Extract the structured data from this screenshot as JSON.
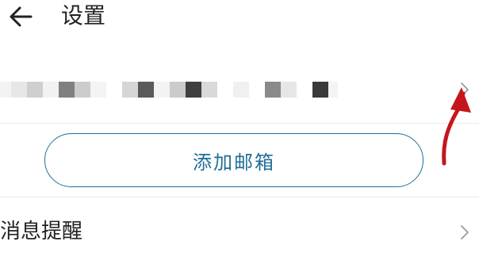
{
  "header": {
    "title": "设置",
    "back_icon": "arrow-left-icon"
  },
  "account": {
    "masked_text": "",
    "chevron_icon": "chevron-right-icon"
  },
  "add_mail": {
    "label": "添加邮箱"
  },
  "notification": {
    "label": "消息提醒",
    "chevron_icon": "chevron-right-icon"
  },
  "annotation": {
    "arrow_icon": "red-pointer-arrow-icon",
    "color": "#c4161c"
  },
  "colors": {
    "accent": "#1f6e97",
    "text": "#222222",
    "divider": "#e9e9e9",
    "chevron": "#9a9a9a"
  }
}
